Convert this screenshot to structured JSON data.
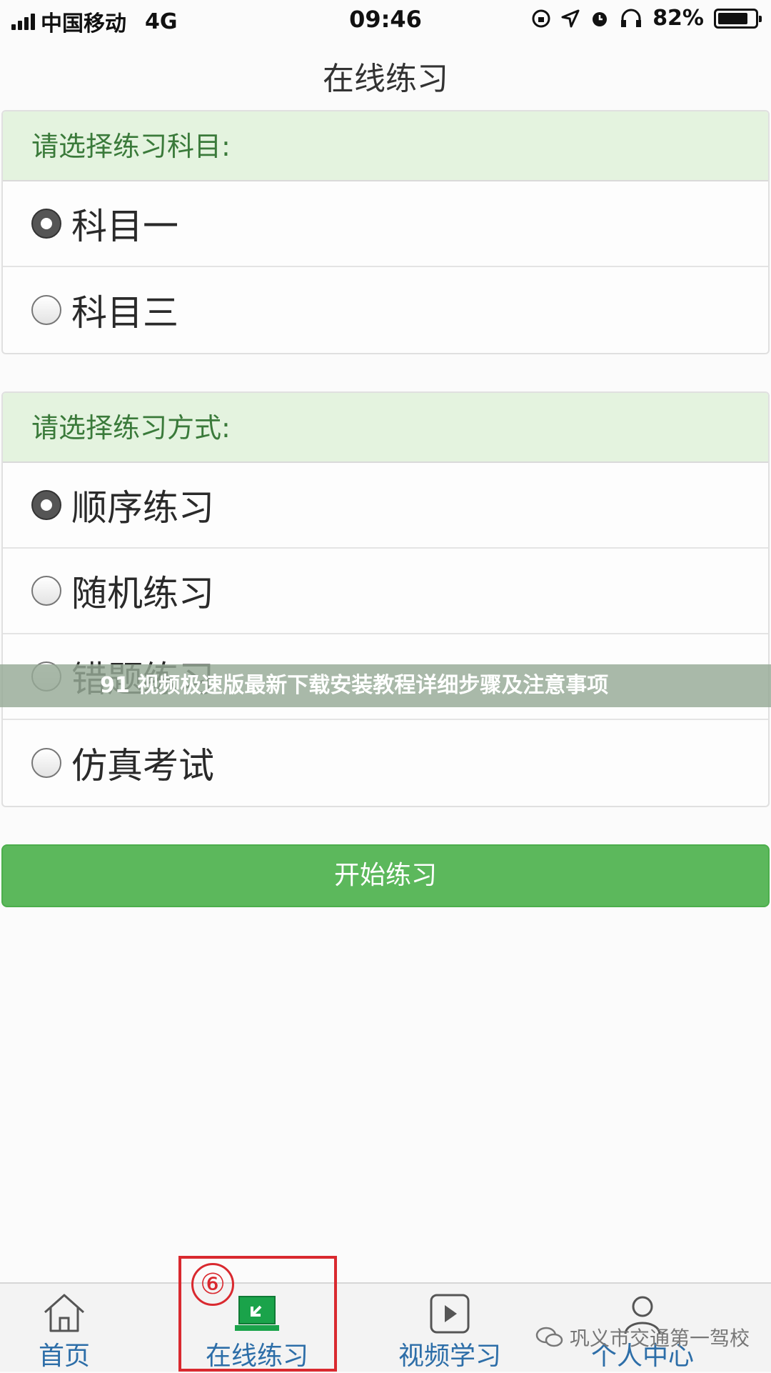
{
  "status_bar": {
    "carrier": "中国移动",
    "network": "4G",
    "time": "09:46",
    "battery": "82%",
    "battery_level": 0.82
  },
  "page_title": "在线练习",
  "subject_section": {
    "header": "请选择练习科目:",
    "options": [
      {
        "label": "科目一",
        "checked": true
      },
      {
        "label": "科目三",
        "checked": false
      }
    ]
  },
  "mode_section": {
    "header": "请选择练习方式:",
    "options": [
      {
        "label": "顺序练习",
        "checked": true
      },
      {
        "label": "随机练习",
        "checked": false
      },
      {
        "label": "错题练习",
        "checked": false
      },
      {
        "label": "仿真考试",
        "checked": false
      }
    ]
  },
  "start_button": "开始练习",
  "overlay_banner": "91 视频极速版最新下载安装教程详细步骤及注意事项",
  "tabbar": {
    "tabs": [
      {
        "label": "首页",
        "icon": "home-icon"
      },
      {
        "label": "在线练习",
        "icon": "practice-monitor-icon"
      },
      {
        "label": "视频学习",
        "icon": "play-icon"
      },
      {
        "label": "个人中心",
        "icon": "user-icon"
      }
    ]
  },
  "annotation": {
    "step": "⑥"
  },
  "watermark": "巩义市交通第一驾校",
  "colors": {
    "accent_green": "#5cb85c",
    "header_bg": "#e4f3df",
    "tab_blue": "#2d6ea8",
    "highlight_red": "#d9292f"
  }
}
